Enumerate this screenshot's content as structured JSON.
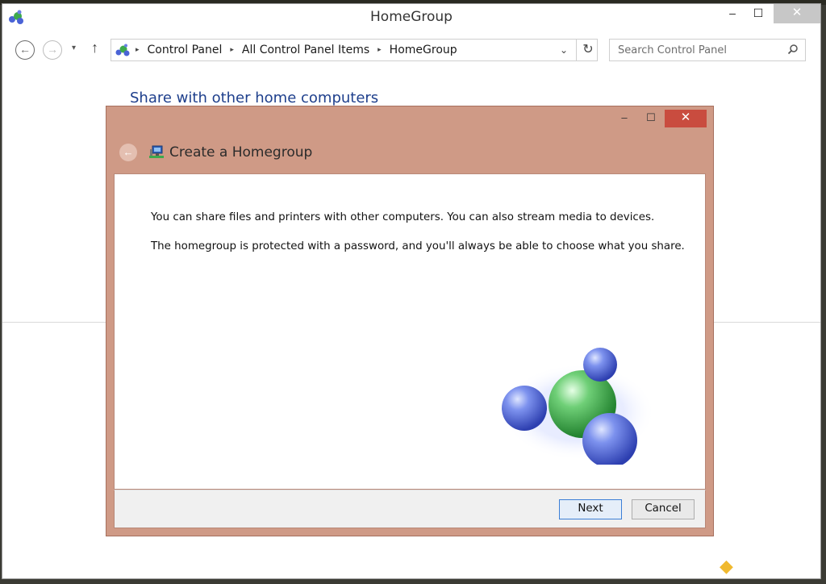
{
  "window": {
    "title": "HomeGroup",
    "controls": {
      "minimize": "‒",
      "maximize": "☐",
      "close": "✕"
    }
  },
  "nav": {
    "back_glyph": "←",
    "forward_glyph": "→",
    "recent_glyph": "▾",
    "up_glyph": "↑"
  },
  "address": {
    "crumbs": [
      "Control Panel",
      "All Control Panel Items",
      "HomeGroup"
    ],
    "separator": "▸",
    "dropdown_glyph": "⌄",
    "refresh_glyph": "↻"
  },
  "search": {
    "placeholder": "Search Control Panel"
  },
  "page": {
    "heading": "Share with other home computers"
  },
  "dialog": {
    "title": "Create a Homegroup",
    "back_glyph": "←",
    "controls": {
      "minimize": "‒",
      "maximize": "☐",
      "close": "✕"
    },
    "paragraph1": "You can share files and printers with other computers. You can also stream media to devices.",
    "paragraph2": "The homegroup is protected with a password, and you'll always be able to choose what you share.",
    "buttons": {
      "next": "Next",
      "cancel": "Cancel"
    }
  },
  "colors": {
    "dialog_frame": "#cf9a86",
    "close_button": "#c94c3f",
    "heading_blue": "#1e3f8c",
    "sphere_blue": "#4a63d6",
    "sphere_green": "#3da94c"
  },
  "icons": {
    "app": "homegroup-icon",
    "search": "magnifier-icon",
    "dialog": "network-computer-icon"
  }
}
